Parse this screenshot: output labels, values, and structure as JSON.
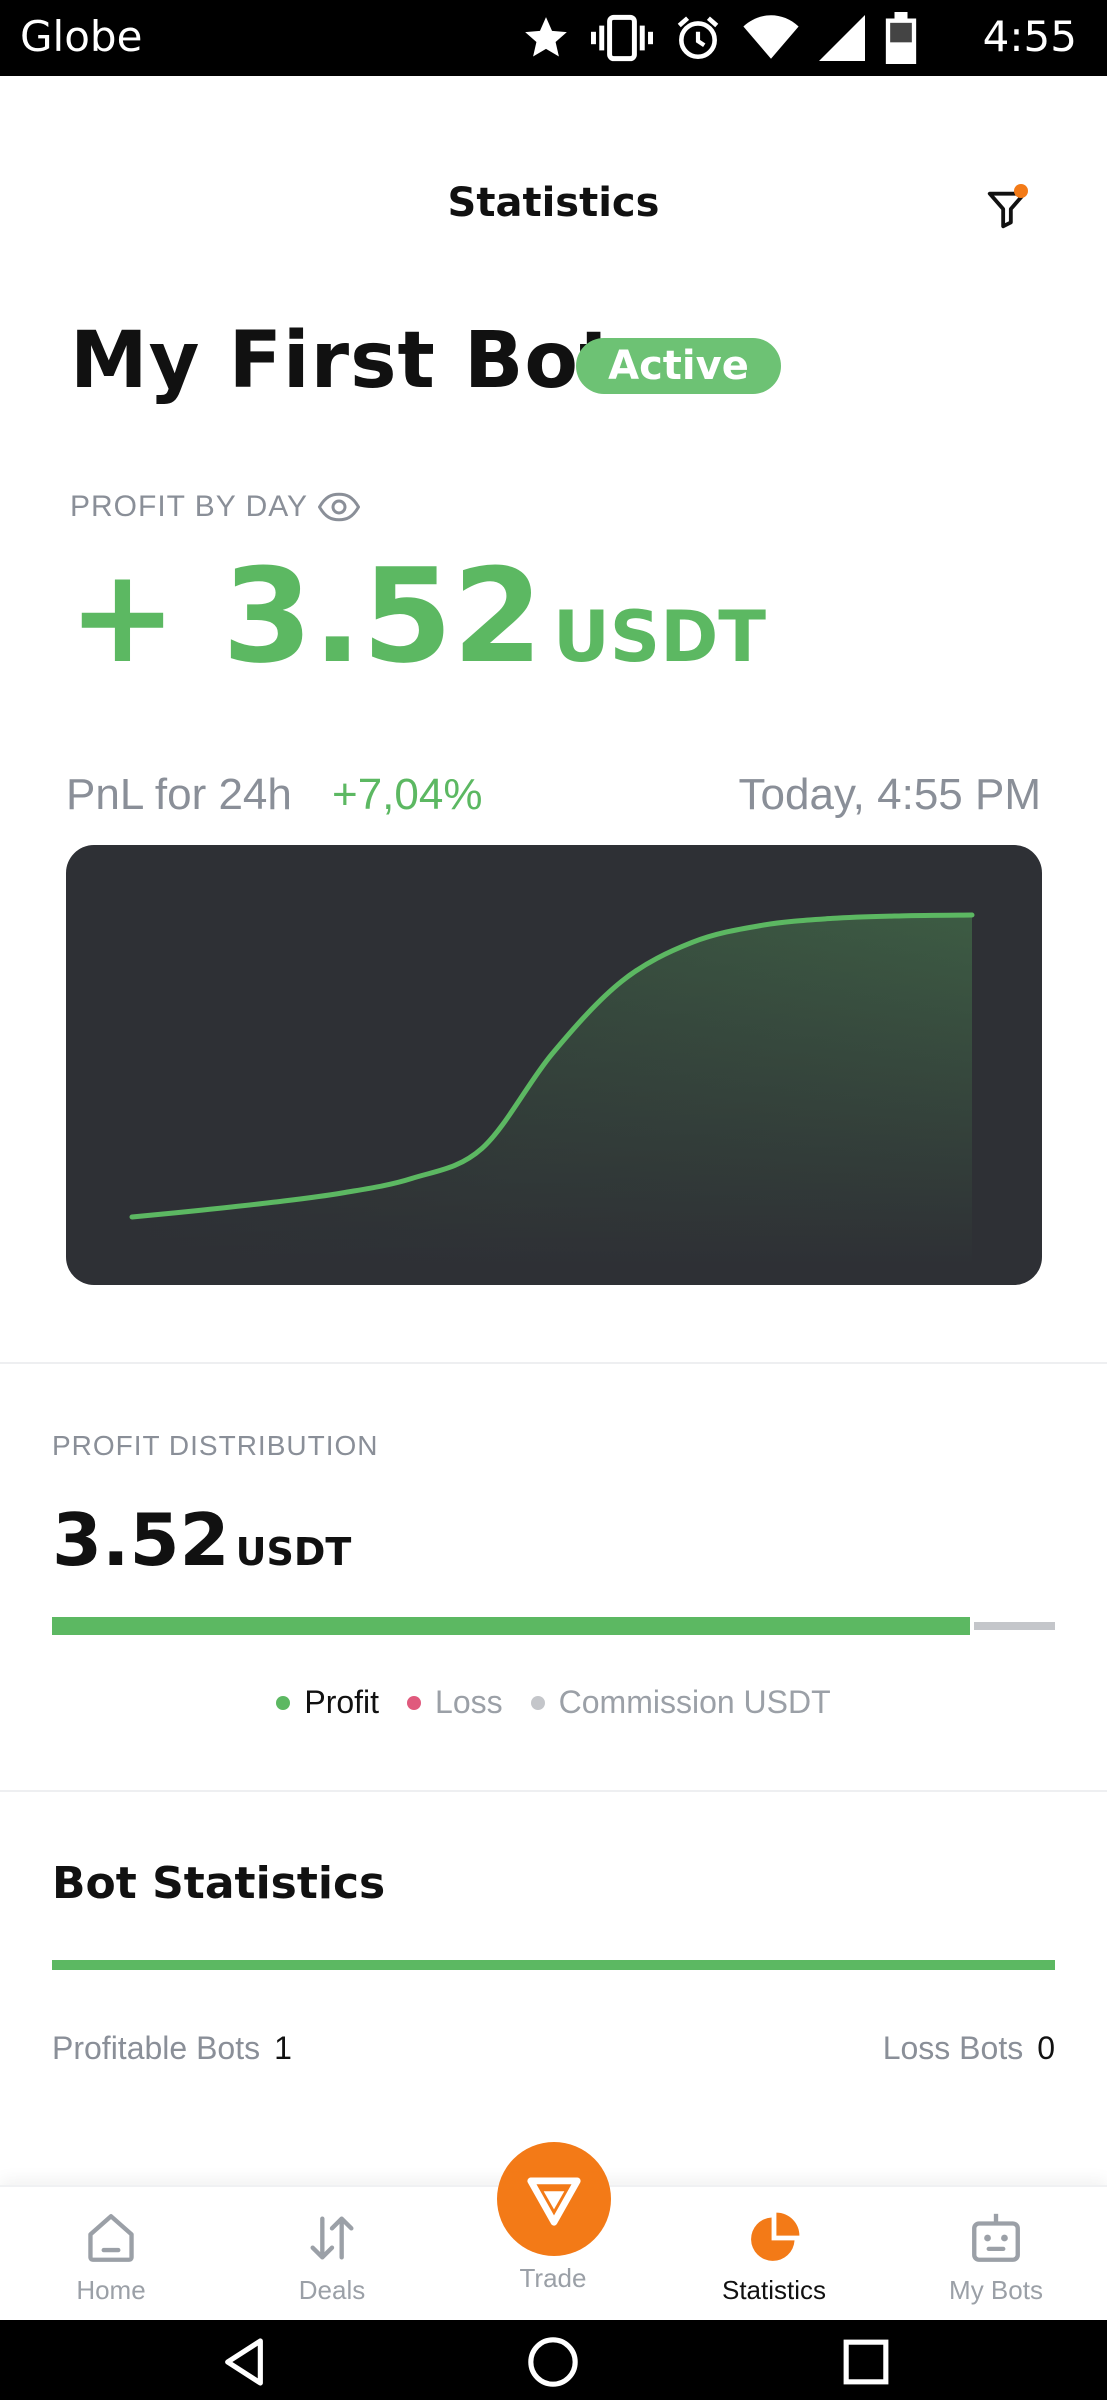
{
  "status_bar": {
    "carrier": "Globe",
    "time": "4:55",
    "icons": [
      "star-icon",
      "vibrate-icon",
      "alarm-icon",
      "wifi-icon",
      "signal-icon",
      "battery-icon"
    ]
  },
  "header": {
    "title": "Statistics",
    "filter_icon": "filter-icon",
    "filter_badge_color": "#f37a17"
  },
  "bot": {
    "name": "My First Bot",
    "status": "Active",
    "status_color": "#6dc274"
  },
  "profit_by_day": {
    "label": "PROFIT BY DAY",
    "visibility_icon": "eye-icon",
    "amount": "+ 3.52",
    "unit": "USDT",
    "color": "#5cb862"
  },
  "pnl": {
    "label": "PnL for 24h",
    "change": "+7,04%",
    "timestamp": "Today, 4:55 PM"
  },
  "chart_data": {
    "type": "area",
    "title": "",
    "xlabel": "",
    "ylabel": "",
    "x": [
      0,
      1,
      2,
      3,
      4,
      5,
      6,
      7,
      8,
      9,
      10,
      11,
      12
    ],
    "series": [
      {
        "values": [
          0.0,
          0.08,
          0.17,
          0.28,
          0.45,
          0.8,
          1.9,
          2.75,
          3.2,
          3.4,
          3.48,
          3.51,
          3.52
        ]
      }
    ],
    "ylim": [
      0,
      3.52
    ],
    "grid": false,
    "line_color": "#5cb862",
    "background": "#2e3035"
  },
  "profit_distribution": {
    "label": "PROFIT DISTRIBUTION",
    "amount": "3.52",
    "unit": "USDT",
    "profit_fraction": 0.915,
    "commission_fraction": 0.085,
    "legend": [
      {
        "label": "Profit",
        "color": "#5cb862",
        "text_color": "#111111"
      },
      {
        "label": "Loss",
        "color": "#e05a7d",
        "text_color": "#9ba0a7"
      },
      {
        "label": "Commission USDT",
        "color": "#c4c6ca",
        "text_color": "#9ba0a7"
      }
    ]
  },
  "bot_statistics": {
    "title": "Bot Statistics",
    "profitable_label": "Profitable Bots",
    "profitable_count": "1",
    "loss_label": "Loss Bots",
    "loss_count": "0"
  },
  "bottom_nav": {
    "items": [
      {
        "label": "Home",
        "icon": "home-icon",
        "active": false
      },
      {
        "label": "Deals",
        "icon": "deals-arrows-icon",
        "active": false
      },
      {
        "label": "Trade",
        "icon": "trade-logo-icon",
        "active": false
      },
      {
        "label": "Statistics",
        "icon": "pie-chart-icon",
        "active": true
      },
      {
        "label": "My Bots",
        "icon": "robot-icon",
        "active": false
      }
    ],
    "accent": "#f37a17"
  }
}
